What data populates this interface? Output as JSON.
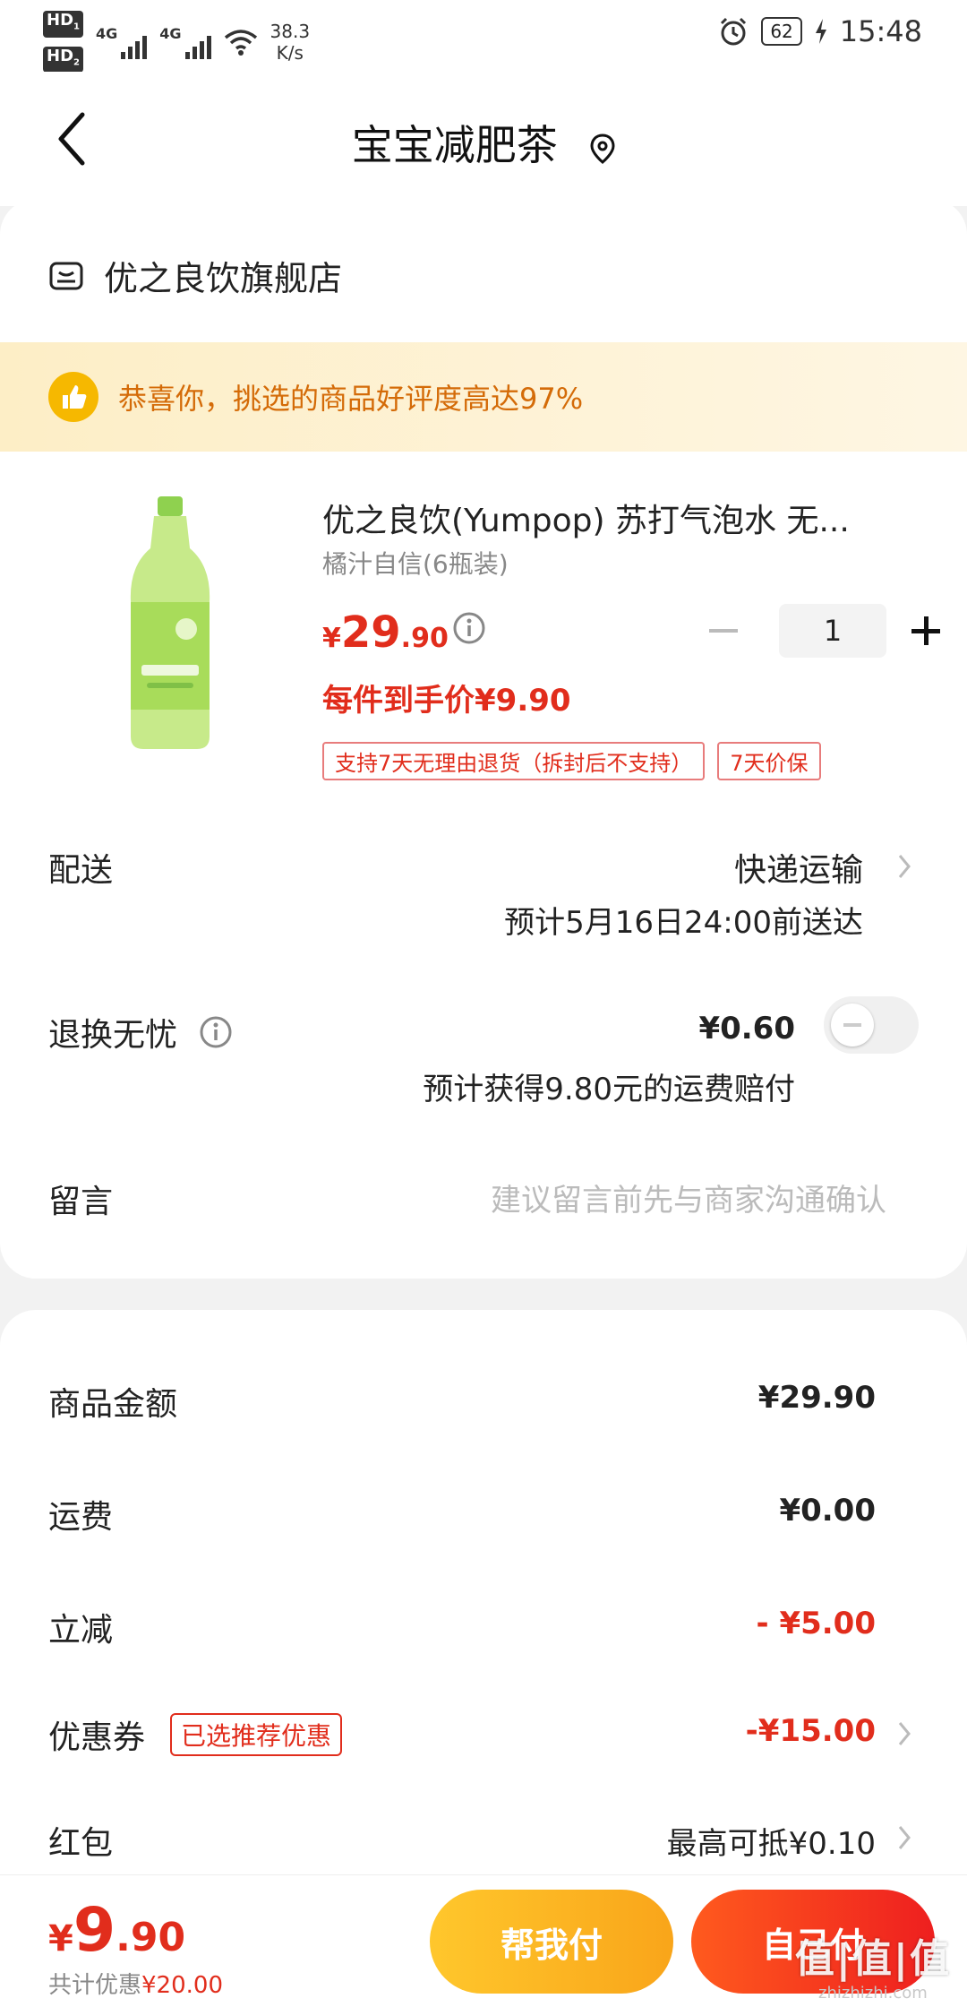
{
  "status_bar": {
    "hd1": "HD",
    "hd1_sub": "1",
    "hd2": "HD",
    "hd2_sub": "2",
    "sig1": "4G",
    "sig2": "4G",
    "speed_value": "38.3",
    "speed_unit": "K/s",
    "battery": "62",
    "time": "15:48",
    "icons": [
      "alarm-icon",
      "wifi-icon",
      "charging-icon"
    ]
  },
  "nav": {
    "title": "宝宝减肥茶",
    "icons": [
      "back-arrow-icon",
      "location-pin-icon"
    ]
  },
  "store": {
    "name": "优之良饮旗舰店"
  },
  "banner": {
    "text": "恭喜你，挑选的商品好评度高达97%"
  },
  "product": {
    "title": "优之良饮(Yumpop) 苏打气泡水 无...",
    "sku": "橘汁自信(6瓶装)",
    "price_symbol": "¥",
    "price_int": "29",
    "price_dec": ".90",
    "hand_price": "每件到手价¥9.90",
    "quantity": "1",
    "tags": [
      "支持7天无理由退货（拆封后不支持）",
      "7天价保"
    ]
  },
  "delivery": {
    "label": "配送",
    "method": "快递运输",
    "estimate": "预计5月16日24:00前送达"
  },
  "returns": {
    "label": "退换无忧",
    "price": "¥0.60",
    "estimate": "预计获得9.80元的运费赔付",
    "toggle_on": false
  },
  "message": {
    "label": "留言",
    "placeholder": "建议留言前先与商家沟通确认"
  },
  "summary": {
    "goods_label": "商品金额",
    "goods_value": "¥29.90",
    "shipping_label": "运费",
    "shipping_value": "¥0.00",
    "discount_label": "立减",
    "discount_value": "- ¥5.00",
    "coupon_label": "优惠券",
    "coupon_tag": "已选推荐优惠",
    "coupon_value": "-¥15.00",
    "redpacket_label": "红包",
    "redpacket_value": "最高可抵¥0.10"
  },
  "bottom": {
    "total_symbol": "¥",
    "total_int": "9",
    "total_dec": ".90",
    "saving_label": "共计优惠",
    "saving_value": "¥20.00",
    "help_pay": "帮我付",
    "self_pay": "自己付"
  },
  "watermark": {
    "big": "值|值|值",
    "small": "zhizhizhi.com"
  },
  "colors": {
    "accent_red": "#e12d1c",
    "banner_orange": "#d46b08",
    "help_button": "#f9a51a",
    "self_button": "#ee1f1f"
  }
}
